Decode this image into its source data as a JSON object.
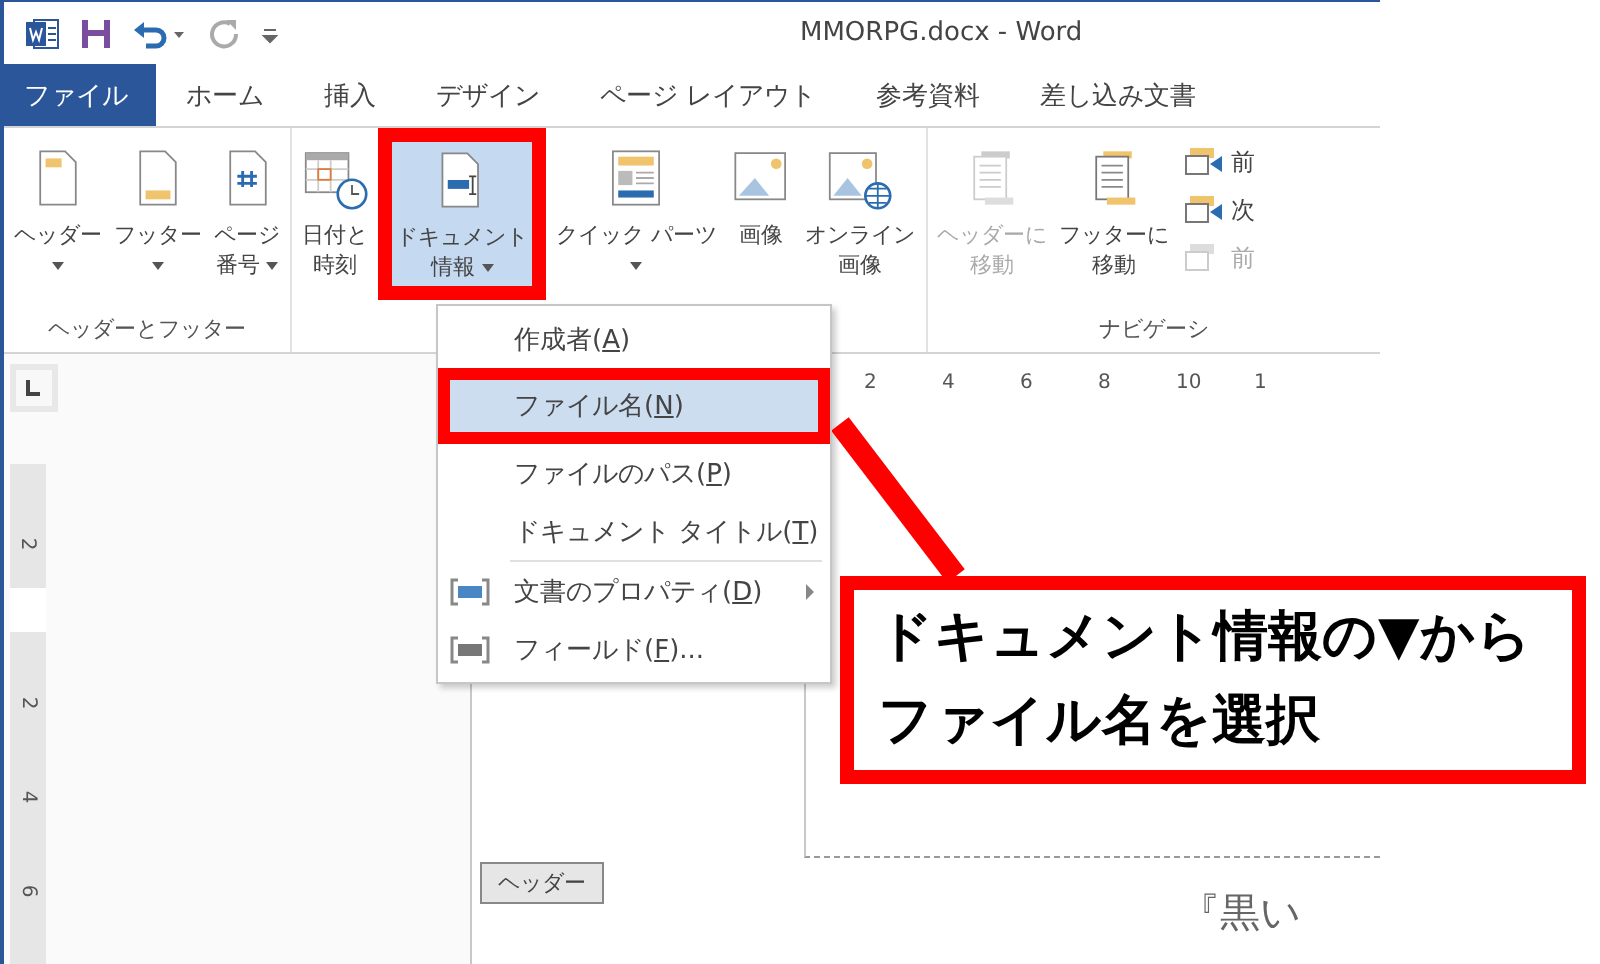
{
  "window": {
    "title": "MMORPG.docx - Word"
  },
  "tabs": [
    {
      "label": "ファイル",
      "kind": "file",
      "selected": false
    },
    {
      "label": "ホーム",
      "kind": "tab",
      "selected": false
    },
    {
      "label": "挿入",
      "kind": "tab",
      "selected": false
    },
    {
      "label": "デザイン",
      "kind": "tab",
      "selected": false
    },
    {
      "label": "ページ レイアウト",
      "kind": "tab",
      "selected": false
    },
    {
      "label": "参考資料",
      "kind": "tab",
      "selected": false
    },
    {
      "label": "差し込み文書",
      "kind": "tab",
      "selected": false
    }
  ],
  "ribbon": {
    "groups": [
      {
        "label": "ヘッダーとフッター",
        "buttons": [
          {
            "lines": [
              "ヘッダー"
            ],
            "dropdown": true,
            "pressed": false,
            "disabled": false
          },
          {
            "lines": [
              "フッター"
            ],
            "dropdown": true,
            "pressed": false,
            "disabled": false
          },
          {
            "lines": [
              "ページ",
              "番号"
            ],
            "dropdown": true,
            "pressed": false,
            "disabled": false
          }
        ]
      },
      {
        "buttons": [
          {
            "lines": [
              "日付と",
              "時刻"
            ],
            "dropdown": false,
            "pressed": false,
            "disabled": false
          },
          {
            "lines": [
              "ドキュメント",
              "情報"
            ],
            "dropdown": true,
            "pressed": true,
            "disabled": false
          },
          {
            "lines": [
              "クイック パーツ"
            ],
            "dropdown": true,
            "pressed": false,
            "disabled": false
          },
          {
            "lines": [
              "画像"
            ],
            "dropdown": false,
            "pressed": false,
            "disabled": false
          },
          {
            "lines": [
              "オンライン",
              "画像"
            ],
            "dropdown": false,
            "pressed": false,
            "disabled": false
          }
        ]
      },
      {
        "label": "ナビゲーシ",
        "buttons": [
          {
            "lines": [
              "ヘッダーに",
              "移動"
            ],
            "dropdown": false,
            "pressed": false,
            "disabled": true
          },
          {
            "lines": [
              "フッターに",
              "移動"
            ],
            "dropdown": false,
            "pressed": false,
            "disabled": false
          }
        ],
        "small_buttons": [
          {
            "label": "前",
            "disabled": false
          },
          {
            "label": "次",
            "disabled": false
          },
          {
            "label": "前",
            "disabled": true
          }
        ]
      }
    ]
  },
  "menu": {
    "items": [
      {
        "before": "作成者(",
        "key": "A",
        "after": ")",
        "selected": false,
        "submenu": false
      },
      {
        "before": "ファイル名(",
        "key": "N",
        "after": ")",
        "selected": true,
        "submenu": false
      },
      {
        "before": "ファイルのパス(",
        "key": "P",
        "after": ")",
        "selected": false,
        "submenu": false
      },
      {
        "before": "ドキュメント タイトル(",
        "key": "T",
        "after": ")",
        "selected": false,
        "submenu": false
      },
      {
        "before": "文書のプロパティ(",
        "key": "D",
        "after": ")",
        "selected": false,
        "submenu": true
      },
      {
        "before": "フィールド(",
        "key": "F",
        "after": ")...",
        "selected": false,
        "submenu": false
      }
    ]
  },
  "ruler": {
    "horizontal": [
      "2",
      "4",
      "6",
      "8",
      "10",
      "1"
    ],
    "vertical": [
      "2",
      "2",
      "4",
      "6"
    ]
  },
  "document": {
    "header_tag": "ヘッダー",
    "header_text": "『黒い"
  },
  "callout": {
    "lines": [
      "ドキュメント情報の▼から",
      "ファイル名を選択"
    ]
  }
}
